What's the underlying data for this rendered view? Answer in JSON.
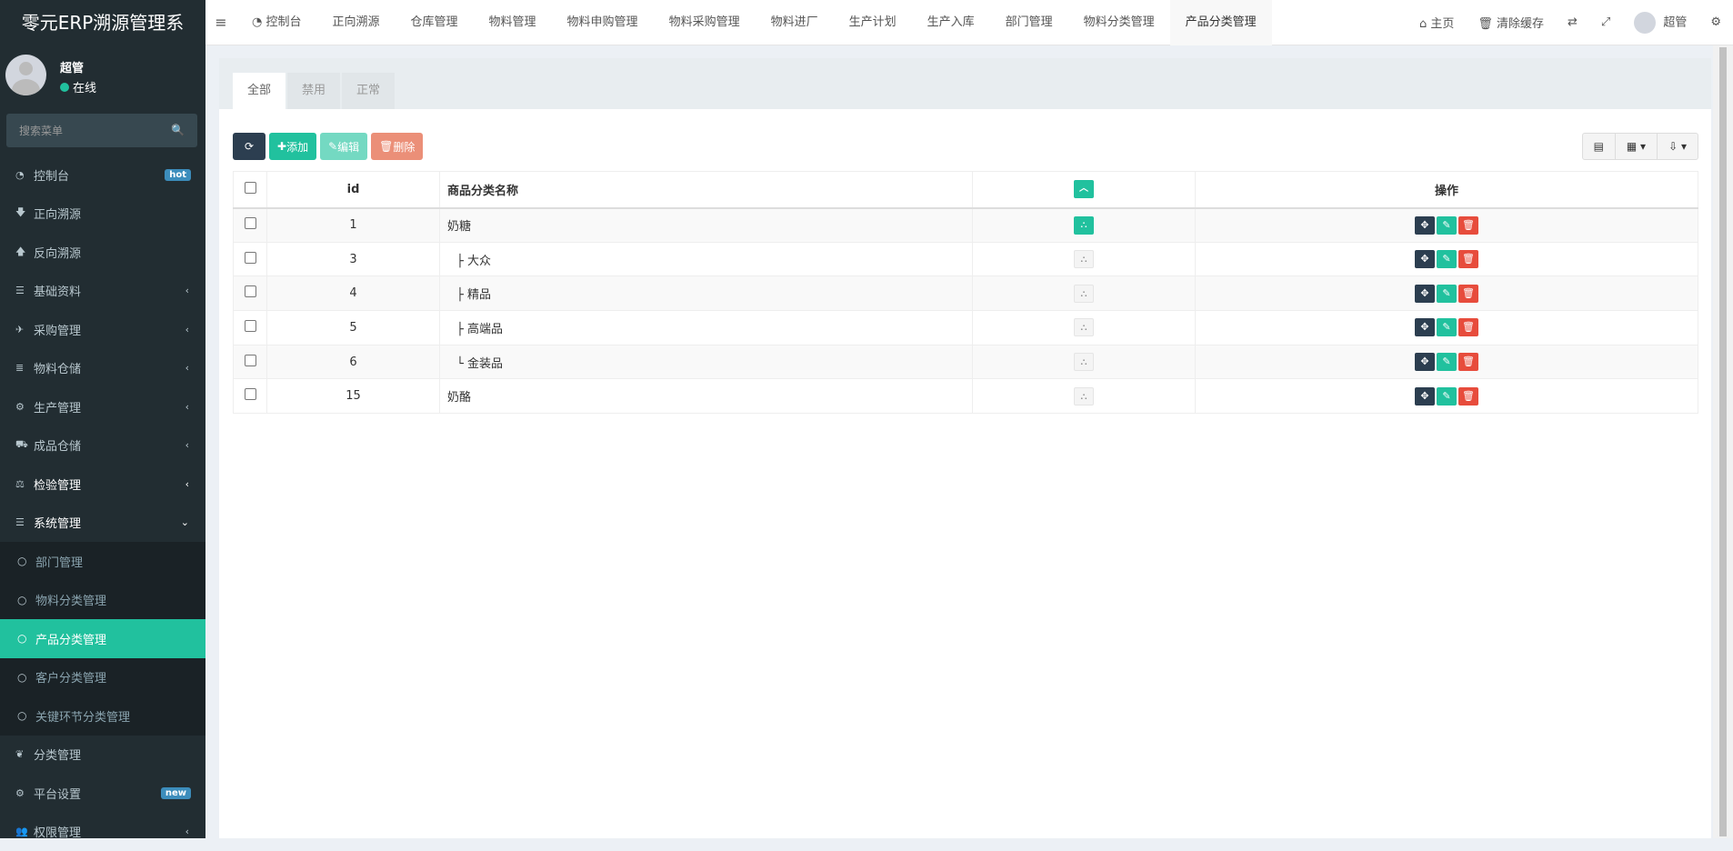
{
  "app": {
    "title": "零元ERP溯源管理系"
  },
  "user": {
    "name": "超管",
    "status": "在线"
  },
  "search": {
    "placeholder": "搜索菜单"
  },
  "menu": [
    {
      "label": "控制台",
      "icon": "dashboard-icon",
      "badge": "hot"
    },
    {
      "label": "正向溯源",
      "icon": "arrow-down-icon"
    },
    {
      "label": "反向溯源",
      "icon": "arrow-up-icon"
    },
    {
      "label": "基础资料",
      "icon": "list-icon"
    },
    {
      "label": "采购管理",
      "icon": "plane-icon"
    },
    {
      "label": "物料仓储",
      "icon": "database-icon"
    },
    {
      "label": "生产管理",
      "icon": "cogs-icon"
    },
    {
      "label": "成品仓储",
      "icon": "road-icon"
    },
    {
      "label": "检验管理",
      "icon": "balance-icon"
    },
    {
      "label": "系统管理",
      "icon": "list-icon"
    }
  ],
  "submenu": [
    {
      "label": "部门管理"
    },
    {
      "label": "物料分类管理"
    },
    {
      "label": "产品分类管理"
    },
    {
      "label": "客户分类管理"
    },
    {
      "label": "关键环节分类管理"
    }
  ],
  "menu2": [
    {
      "label": "分类管理",
      "icon": "leaf-icon"
    },
    {
      "label": "平台设置",
      "icon": "cogs-icon",
      "badge": "new"
    },
    {
      "label": "权限管理",
      "icon": "users-icon"
    }
  ],
  "header": {
    "tabs": [
      "控制台",
      "正向溯源",
      "仓库管理",
      "物料管理",
      "物料申购管理",
      "物料采购管理",
      "物料进厂",
      "生产计划",
      "生产入库",
      "部门管理",
      "物料分类管理",
      "产品分类管理"
    ],
    "home": "主页",
    "clear_cache": "清除缓存",
    "username": "超管"
  },
  "panel": {
    "tabs": [
      "全部",
      "禁用",
      "正常"
    ],
    "toolbar": {
      "add": "添加",
      "edit": "编辑",
      "delete": "删除"
    },
    "columns": {
      "id": "id",
      "name": "商品分类名称",
      "ops": "操作"
    },
    "rows": [
      {
        "id": "1",
        "name": "奶糖",
        "expand": true
      },
      {
        "id": "3",
        "name": "├ 大众"
      },
      {
        "id": "4",
        "name": "├ 精品"
      },
      {
        "id": "5",
        "name": "├ 高端品"
      },
      {
        "id": "6",
        "name": "└ 金装品"
      },
      {
        "id": "15",
        "name": "奶酪"
      }
    ]
  }
}
